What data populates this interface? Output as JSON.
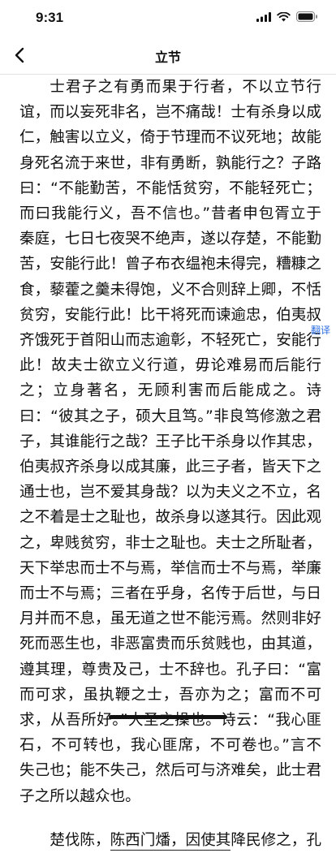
{
  "status_bar": {
    "time": "9:31",
    "icons": [
      "signal-icon",
      "wifi-icon",
      "battery-icon"
    ]
  },
  "nav": {
    "title": "立节",
    "back_icon": "chevron-left-icon"
  },
  "content": {
    "paragraph_1": "士君子之有勇而果于行者，不以立节行谊，而以妄死非名，岂不痛哉！士有杀身以成仁，触害以立义，倚于节理而不议死地；故能身死名流于来世，非有勇断，孰能行之？子路曰：“不能勤苦，不能恬贫穷，不能轻死亡；而曰我能行义，吾不信也。”昔者申包胥立于秦庭，七日七夜哭不绝声，遂以存楚，不能勤苦，安能行此！曾子布衣缊袍未得完，糟糠之食，藜藿之羹未得饱，义不合则辞上卿，不恬贫穷，安能行此！比干将死而谏逾忠，伯夷叔齐饿死于首阳山而志逾彰，不轻死亡，安能行此！故夫士欲立义行道，毋论难易而后能行之；立身著名，无顾利害而后能成之。诗曰：“彼其之子，硕大且笃。”非良笃修激之君子，其谁能行之哉？王子比干杀身以作其忠，伯夷叔齐杀身以成其廉，此三子者，皆天下之通士也，岂不爱其身哉？以为夫义之不立，名之不着是士之耻也，故杀身以遂其行。因此观之，卑贱贫穷，非士之耻也。夫士之所耻者，天下举忠而士不与焉，举信而士不与焉，举廉而士不与焉；三者在乎身，名传于后世，与日月并而不息，虽无道之世不能污焉。然则非好死而恶生也，非恶富贵而乐贫贱也，由其道，遵其理，尊贵及己，士不辞也。孔子曰：“富而可求，虽执鞭之士，吾亦为之；富而不可求，从吾所好。”大圣之操也。诗云：“我心匪石，不可转也，我心匪席，不可卷也。”言不失己也；能不失己，然后可与济难矣，此士君子之所以越众也。",
    "paragraph_2_prefix": "楚伐陈，",
    "paragraph_2_underlined": "陈西门燔，因使其",
    "paragraph_2_suffix": "降民修之，孔"
  },
  "translate_label": "翻译"
}
